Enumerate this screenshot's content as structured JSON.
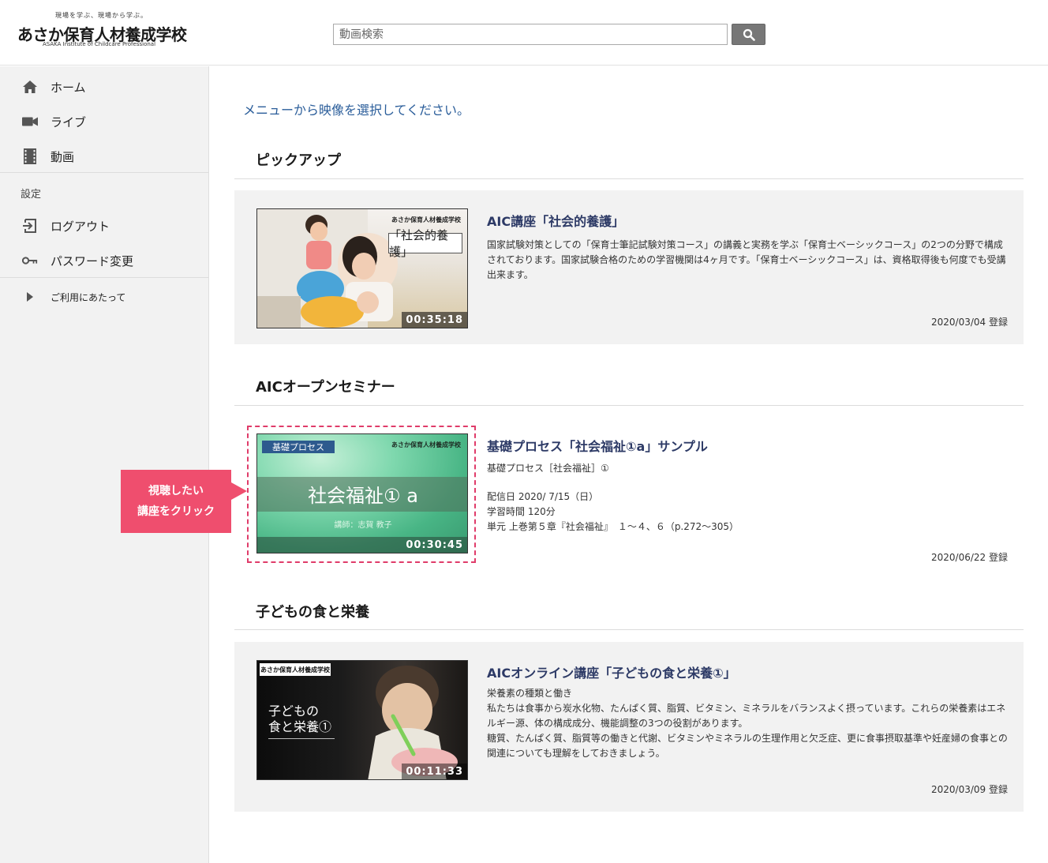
{
  "header": {
    "logo_tagline": "現場を学ぶ、現場から学ぶ。",
    "logo_name": "あさか保育人材養成学校",
    "logo_en": "ASAKA Institute of Childcare Professional",
    "search_placeholder": "動画検索"
  },
  "sidebar": {
    "items": [
      {
        "label": "ホーム",
        "icon": "home-icon"
      },
      {
        "label": "ライブ",
        "icon": "video-camera-icon"
      },
      {
        "label": "動画",
        "icon": "film-icon"
      }
    ],
    "settings_heading": "設定",
    "settings_items": [
      {
        "label": "ログアウト",
        "icon": "logout-icon"
      },
      {
        "label": "パスワード変更",
        "icon": "key-icon"
      }
    ],
    "extra_item": {
      "label": "ご利用にあたって",
      "icon": "triangle-right-icon"
    }
  },
  "main": {
    "instruction": "メニューから映像を選択してください。",
    "sections": [
      {
        "title": "ピックアップ",
        "card": {
          "title": "AIC講座「社会的養護」",
          "description": "国家試験対策としての「保育士筆記試験対策コース」の講義と実務を学ぶ「保育士ベーシックコース」の2つの分野で構成されております。国家試験合格のための学習機関は4ヶ月です。「保育士ベーシックコース」は、資格取得後も何度でも受講出来ます。",
          "date": "2020/03/04 登録",
          "duration": "00:35:18",
          "thumb_sign": "「社会的養護」",
          "thumb_logo": "あさか保育人材養成学校"
        }
      },
      {
        "title": "AICオープンセミナー",
        "card": {
          "title": "基礎プロセス「社会福祉①a」サンプル",
          "description_lines": [
            "基礎プロセス［社会福祉］①",
            "",
            "配信日 2020/ 7/15（日）",
            "学習時間 120分",
            "単元 上巻第５章『社会福祉』　１～４、６（p.272～305）"
          ],
          "date": "2020/06/22 登録",
          "duration": "00:30:45",
          "thumb_tag": "基礎プロセス",
          "thumb_title": "社会福祉① a",
          "thumb_sub": "講師：志賀 教子",
          "thumb_logo": "あさか保育人材養成学校"
        }
      },
      {
        "title": "子どもの食と栄養",
        "card": {
          "title": "AICオンライン講座「子どもの食と栄養①」",
          "description_lines": [
            "栄養素の種類と働き",
            "私たちは食事から炭水化物、たんぱく質、脂質、ビタミン、ミネラルをバランスよく摂っています。これらの栄養素はエネルギー源、体の構成成分、機能調整の3つの役割があります。",
            "糖質、たんぱく質、脂質等の働きと代謝、ビタミンやミネラルの生理作用と欠乏症、更に食事摂取基準や妊産婦の食事との関連についても理解をしておきましょう。"
          ],
          "date": "2020/03/09 登録",
          "duration": "00:11:33",
          "thumb_title_1": "子どもの",
          "thumb_title_2": "食と栄養①",
          "thumb_logo": "あさか保育人材養成学校"
        }
      }
    ]
  },
  "callout": {
    "line1": "視聴したい",
    "line2": "講座をクリック"
  },
  "colors": {
    "accent_title": "#2d3a66",
    "link_blue": "#2a5d9a",
    "callout": "#ef4e6e",
    "sidebar_bg": "#f2f2f2"
  }
}
